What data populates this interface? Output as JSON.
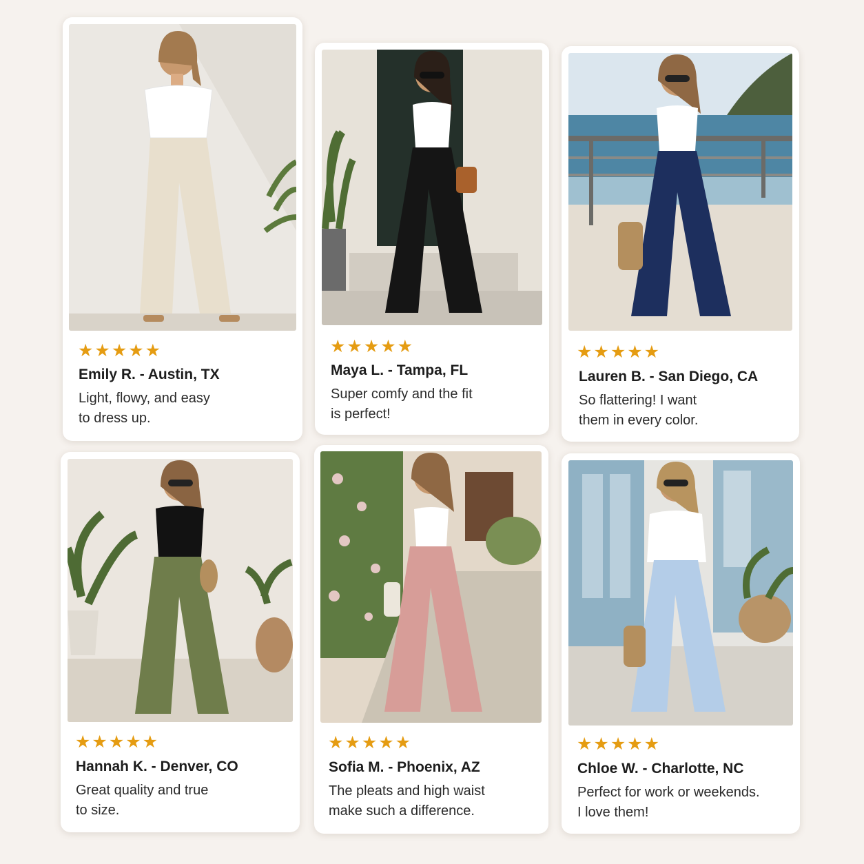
{
  "colors": {
    "background": "#f6f2ee",
    "star": "#e59c12"
  },
  "reviews": [
    {
      "stars": "★★★★★",
      "rating": 5,
      "reviewer": "Emily R. - Austin, TX",
      "quote": "Light, flowy, and easy\nto dress up.",
      "pants_color": "#e8dfcd",
      "top_color": "#ffffff",
      "scene": "white-wall-with-palm"
    },
    {
      "stars": "★★★★★",
      "rating": 5,
      "reviewer": "Maya L. - Tampa, FL",
      "quote": "Super comfy and the fit\nis perfect!",
      "pants_color": "#151515",
      "top_color": "#ffffff",
      "scene": "doorway-with-plant"
    },
    {
      "stars": "★★★★★",
      "rating": 5,
      "reviewer": "Lauren B. - San Diego, CA",
      "quote": "So flattering! I want\nthem in every color.",
      "pants_color": "#1d2f5e",
      "top_color": "#ffffff",
      "scene": "seaside-boardwalk"
    },
    {
      "stars": "★★★★★",
      "rating": 5,
      "reviewer": "Hannah K. - Denver, CO",
      "quote": "Great quality and true\nto size.",
      "pants_color": "#6f7d4b",
      "top_color": "#121212",
      "scene": "patio-with-potted-plants"
    },
    {
      "stars": "★★★★★",
      "rating": 5,
      "reviewer": "Sofia M. - Phoenix, AZ",
      "quote": "The pleats and high waist\nmake such a difference.",
      "pants_color": "#d79d98",
      "top_color": "#ffffff",
      "scene": "garden-path"
    },
    {
      "stars": "★★★★★",
      "rating": 5,
      "reviewer": "Chloe W. - Charlotte, NC",
      "quote": "Perfect for work or weekends.\nI love them!",
      "pants_color": "#b4cde8",
      "top_color": "#ffffff",
      "scene": "blue-doors-porch"
    }
  ]
}
